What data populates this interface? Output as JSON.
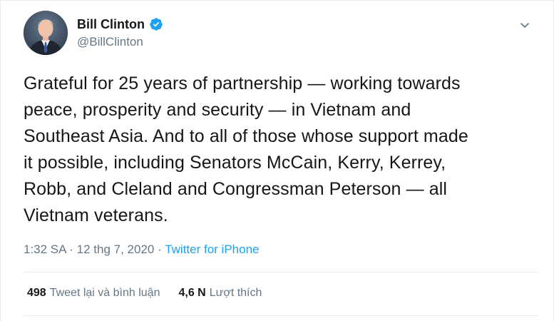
{
  "author": {
    "display_name": "Bill Clinton",
    "handle": "@BillClinton",
    "verified": true
  },
  "tweet": {
    "text": "Grateful for 25 years of partnership — working towards\npeace, prosperity and security — in Vietnam and\nSoutheast Asia. And to all of those whose support made\nit possible, including Senators McCain, Kerry, Kerrey,\nRobb, and Cleland and Congressman Peterson — all\nVietnam veterans.",
    "time": "1:32 SA",
    "separator_1": " · ",
    "date": "12 thg 7, 2020",
    "separator_2": " · ",
    "source": "Twitter for iPhone"
  },
  "stats": {
    "retweets_count": "498",
    "retweets_label": "Tweet lại và bình luận",
    "likes_count": "4,6 N",
    "likes_label": "Lượt thích"
  },
  "icons": {
    "verified": "verified-badge-icon",
    "caret": "chevron-down-icon"
  },
  "colors": {
    "accent": "#1da1f2",
    "text": "#14171a",
    "secondary": "#657786",
    "border": "#e6ecf0"
  }
}
